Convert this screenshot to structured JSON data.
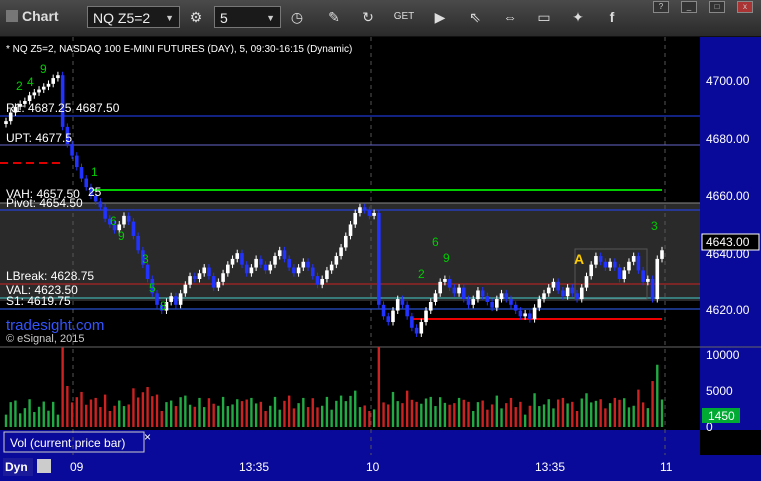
{
  "toolbar": {
    "title": "Chart",
    "symbol": "NQ Z5=2",
    "interval": "5",
    "window_controls": [
      "?",
      "_",
      "□",
      "x"
    ]
  },
  "chart": {
    "header": "* NQ Z5=2, NASDAQ 100 E-MINI FUTURES (DAY), 5, 09:30-16:15 (Dynamic)",
    "watermark": "tradesight.com",
    "copyright": "© eSignal, 2015",
    "marker_a": "A",
    "current_price": "4643.00",
    "price_ticks": [
      "4700.00",
      "4680.00",
      "4660.00",
      "4640.00",
      "4620.00"
    ],
    "volume_ticks": [
      "10000",
      "5000",
      "0"
    ],
    "current_volume": "1450",
    "volume_label": "Vol (current price bar)",
    "close_label": "×",
    "time_ticks": [
      "09",
      "13:35",
      "10",
      "13:35",
      "11"
    ],
    "mode_label": "Dyn",
    "levels": [
      {
        "label": "R1: 4687.25",
        "extra": "4687.50"
      },
      {
        "label": "UPT: 4677.5"
      },
      {
        "label": "VAH: 4657.50",
        "extra": "25"
      },
      {
        "label": "Pivot: 4654.50"
      },
      {
        "label": "LBreak: 4628.75"
      },
      {
        "label": "VAL: 4623.50"
      },
      {
        "label": "S1: 4619.75"
      }
    ],
    "colors": {
      "up": "#ffffff",
      "down": "#2233ff",
      "accent": "#ffcc00",
      "green": "#00cc00",
      "red": "#e00000"
    }
  },
  "chart_data": {
    "type": "candlestick",
    "price_axis": {
      "min": 4610,
      "max": 4710,
      "ticks": [
        4700,
        4680,
        4660,
        4640,
        4620
      ]
    },
    "volume_axis": {
      "min": 0,
      "max": 11000,
      "ticks": [
        10000,
        5000,
        0
      ]
    },
    "last_price": 4643.0,
    "last_volume": 1450,
    "levels": {
      "R1": 4687.25,
      "UPT": 4677.5,
      "VAH": 4657.5,
      "Pivot": 4654.5,
      "LBreak": 4628.75,
      "VAL": 4623.5,
      "S1": 4619.75
    },
    "sessions": [
      "09",
      "10",
      "11"
    ],
    "close": [
      4688,
      4691,
      4693,
      4694,
      4695,
      4697,
      4698,
      4699,
      4700,
      4701,
      4703,
      4704,
      4686,
      4680,
      4676,
      4672,
      4668,
      4665,
      4662,
      4660,
      4658,
      4654,
      4652,
      4650,
      4652,
      4655,
      4653,
      4648,
      4643,
      4638,
      4633,
      4628,
      4624,
      4622,
      4625,
      4627,
      4624,
      4628,
      4631,
      4634,
      4633,
      4635,
      4637,
      4634,
      4630,
      4632,
      4635,
      4638,
      4640,
      4642,
      4638,
      4635,
      4637,
      4640,
      4638,
      4636,
      4638,
      4641,
      4643,
      4640,
      4637,
      4635,
      4637,
      4639,
      4637,
      4634,
      4631,
      4633,
      4636,
      4638,
      4641,
      4644,
      4648,
      4652,
      4656,
      4658,
      4657,
      4655,
      4656,
      4624,
      4620,
      4618,
      4622,
      4626,
      4624,
      4620,
      4616,
      4614,
      4618,
      4622,
      4625,
      4628,
      4632,
      4633,
      4630,
      4628,
      4630,
      4626,
      4624,
      4626,
      4629,
      4627,
      4625,
      4623,
      4626,
      4628,
      4626,
      4624,
      4622,
      4620,
      4621,
      4619,
      4623,
      4626,
      4628,
      4630,
      4632,
      4629,
      4627,
      4630,
      4628,
      4626,
      4630,
      4634,
      4638,
      4641,
      4639,
      4637,
      4639,
      4637,
      4633,
      4636,
      4639,
      4641,
      4636,
      4632,
      4633,
      4626,
      4640,
      4643
    ]
  }
}
